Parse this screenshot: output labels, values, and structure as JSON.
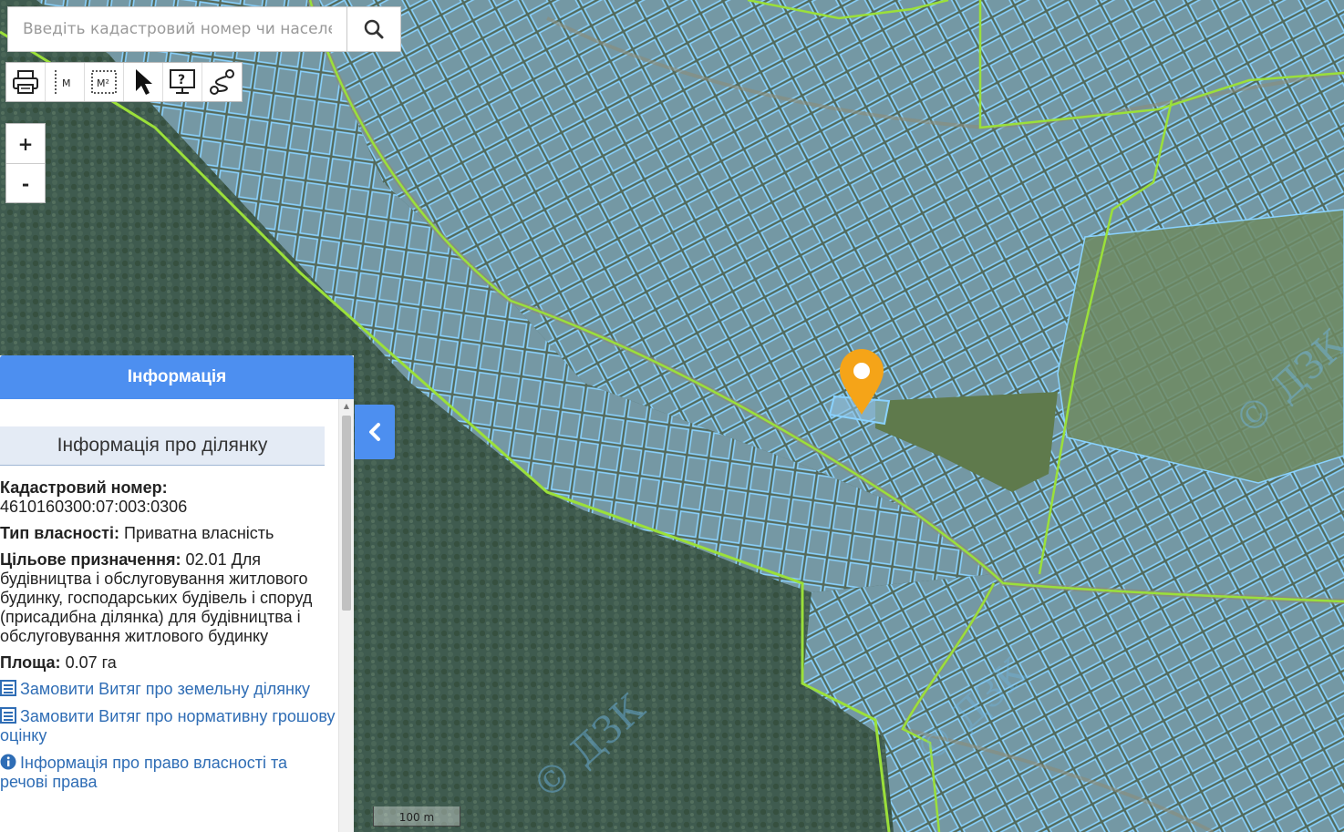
{
  "search": {
    "placeholder": "Введіть кадастровий номер чи населе"
  },
  "toolbar": {
    "tools": [
      {
        "name": "print-icon"
      },
      {
        "name": "measure-distance-icon",
        "label": "M"
      },
      {
        "name": "measure-area-icon",
        "label": "M²"
      },
      {
        "name": "pointer-icon"
      },
      {
        "name": "help-icon"
      },
      {
        "name": "route-icon"
      }
    ]
  },
  "zoom": {
    "in_label": "+",
    "out_label": "-"
  },
  "panel": {
    "header": "Інформація",
    "section_title": "Інформація про ділянку",
    "cadastral_label": "Кадастровий номер:",
    "cadastral_value": "4610160300:07:003:0306",
    "ownership_label": "Тип власності:",
    "ownership_value": "Приватна власність",
    "purpose_label": "Цільове призначення:",
    "purpose_value": "02.01 Для будівництва і обслуговування житлового будинку, господарських будівель і споруд (присадибна ділянка) для будівництва і обслуговування житлового будинку",
    "area_label": "Площа:",
    "area_value": "0.07 га",
    "link_extract_land": "Замовити Витяг про земельну ділянку",
    "link_extract_valuation": "Замовити Витяг про нормативну грошову оцінку",
    "link_ownership_info": "Інформація про право власності та речові права"
  },
  "map": {
    "scale_label": "100 m",
    "watermark": "© ДЗК",
    "colors": {
      "forest": "#3e5a4e",
      "parcel_fill": "#8fc6ee",
      "parcel_stroke": "#7fd0ff",
      "boundary": "#9be03a",
      "marker": "#f5a418"
    }
  }
}
